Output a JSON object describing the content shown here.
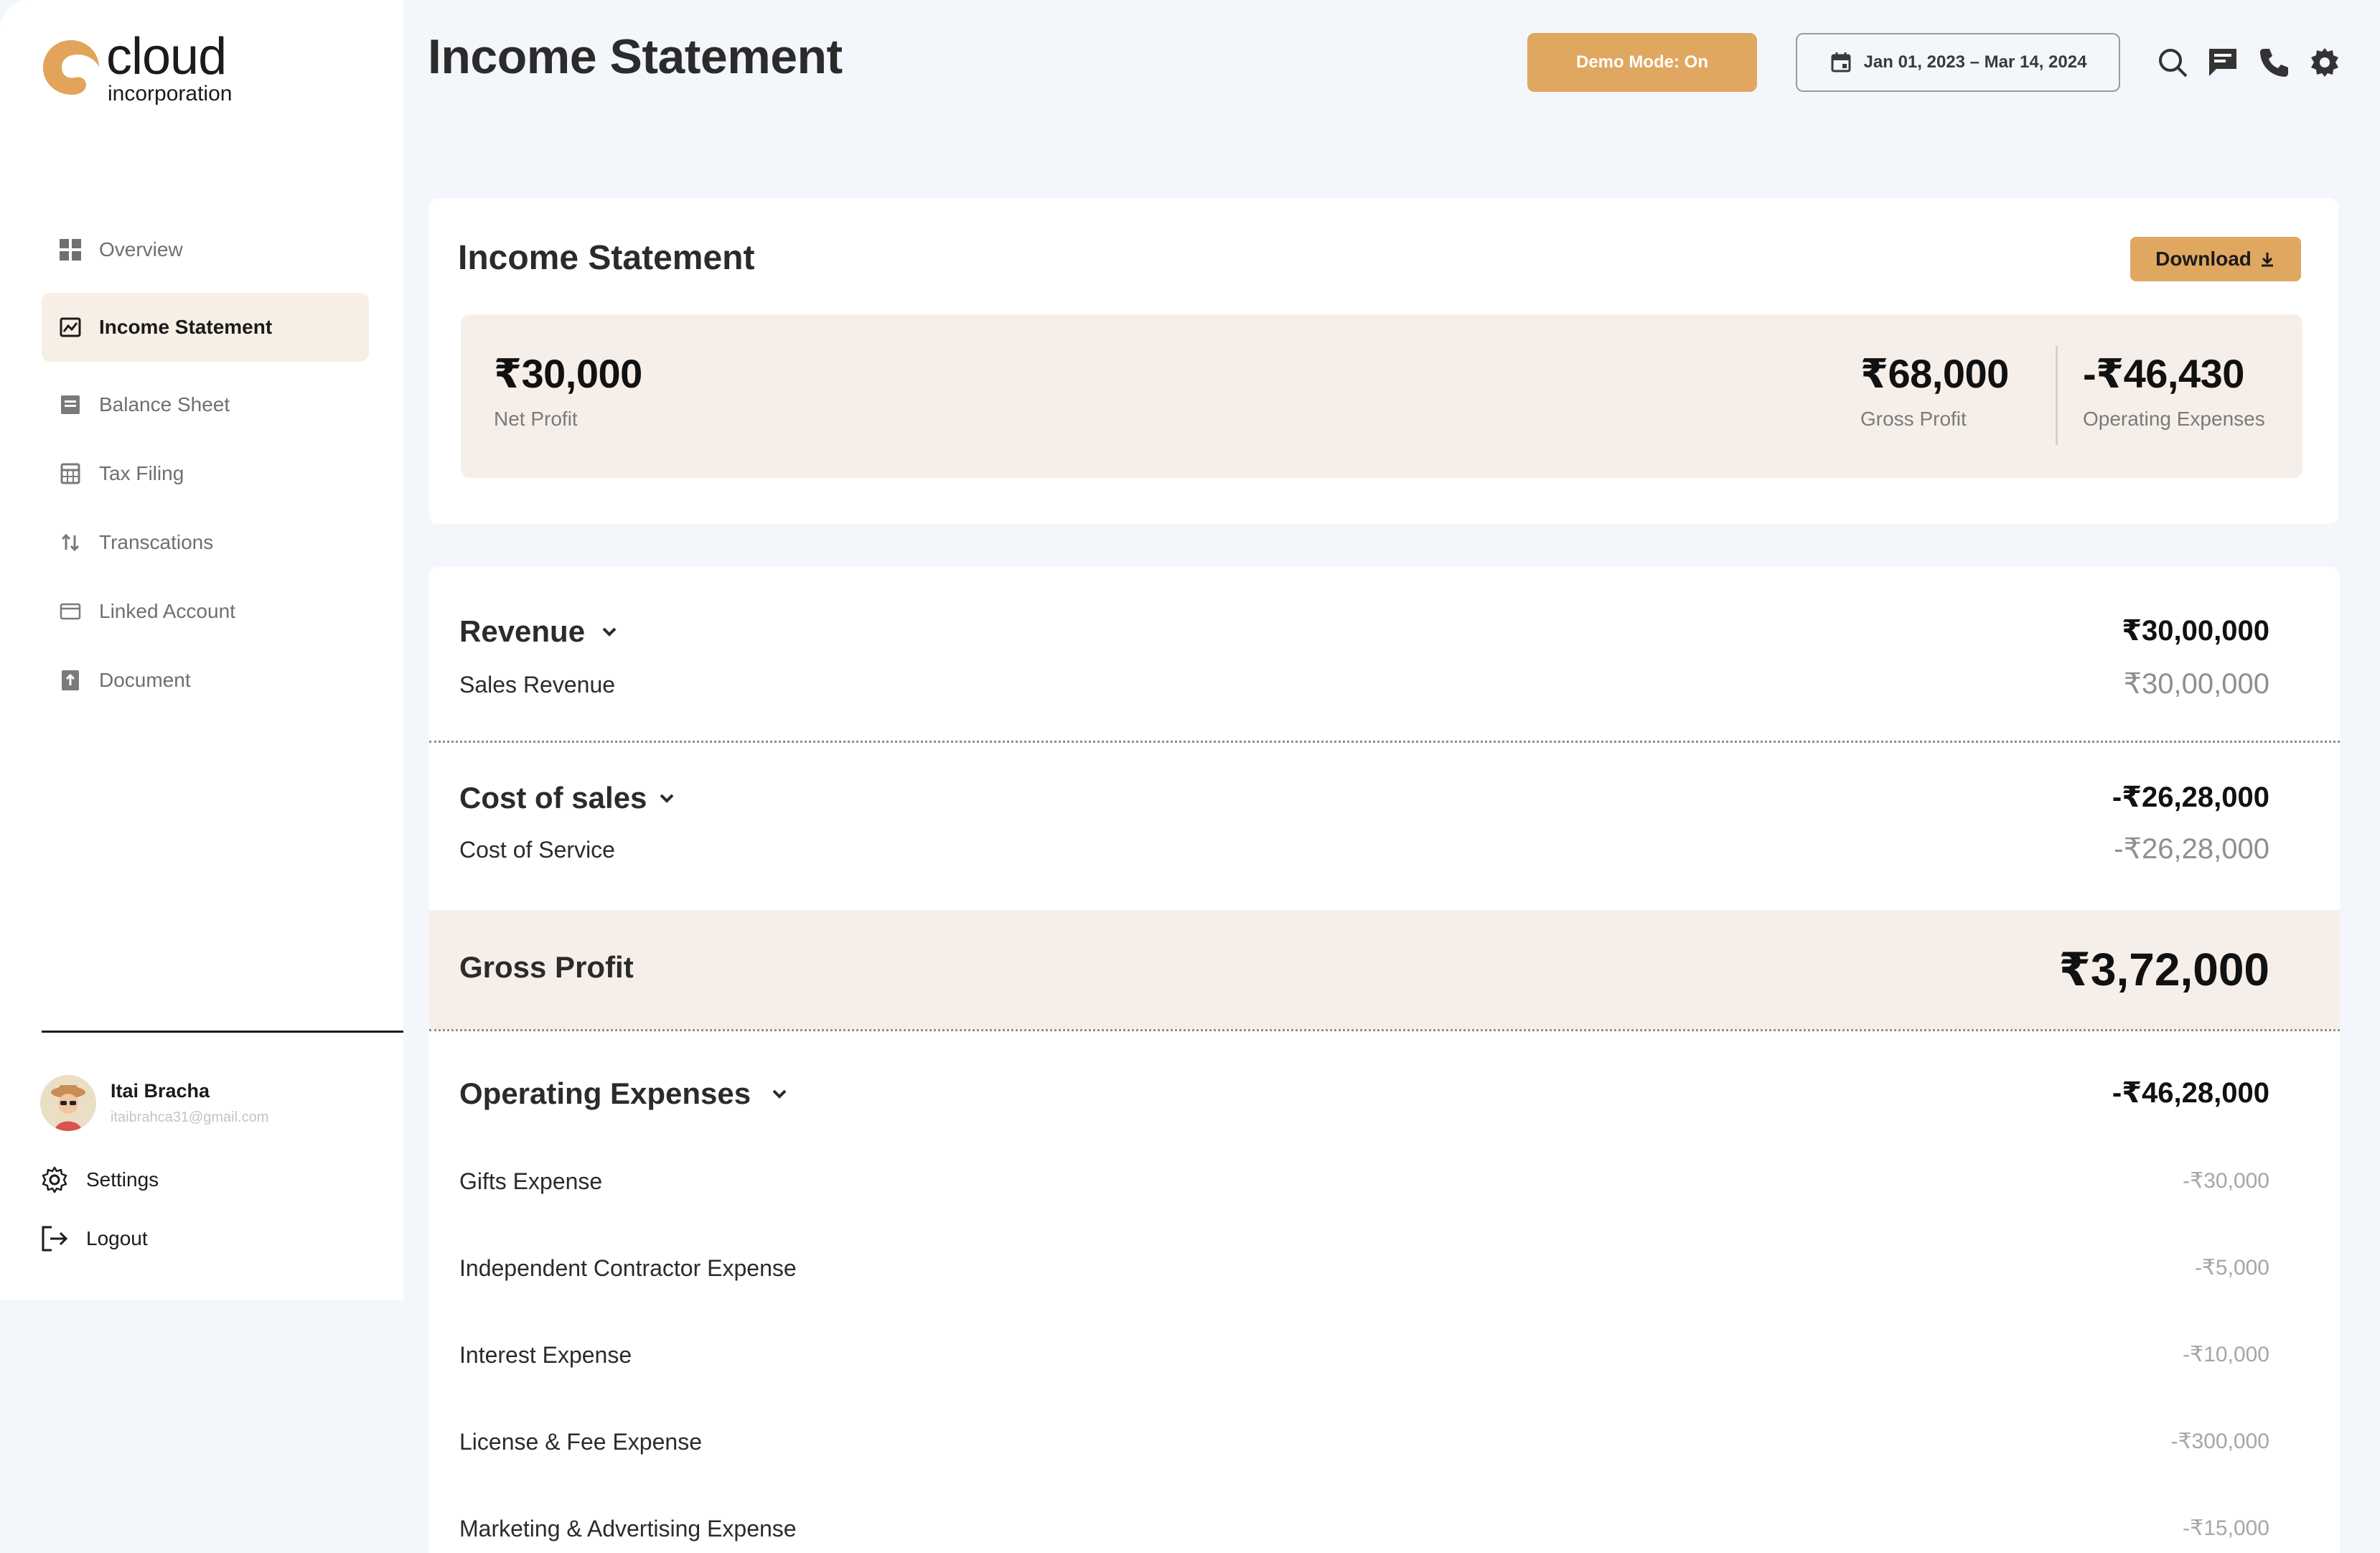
{
  "brand": {
    "name": "cloud",
    "sub": "incorporation",
    "accent": "#dfa75f"
  },
  "sidebar": {
    "items": [
      {
        "label": "Overview",
        "icon": "grid-icon"
      },
      {
        "label": "Income Statement",
        "icon": "chart-image-icon",
        "active": true
      },
      {
        "label": "Balance Sheet",
        "icon": "sheet-icon"
      },
      {
        "label": "Tax Filing",
        "icon": "calculator-icon"
      },
      {
        "label": "Transcations",
        "icon": "sort-arrows-icon"
      },
      {
        "label": "Linked Account",
        "icon": "card-icon"
      },
      {
        "label": "Document",
        "icon": "document-icon"
      }
    ],
    "user": {
      "name": "Itai Bracha",
      "email": "itaibrahca31@gmail.com"
    },
    "settings_label": "Settings",
    "logout_label": "Logout"
  },
  "header": {
    "title": "Income Statement",
    "demo_label": "Demo Mode: On",
    "date_range": "Jan 01, 2023 – Mar 14, 2024"
  },
  "summary_card": {
    "title": "Income Statement",
    "download_label": "Download",
    "net_profit": {
      "value": "₹30,000",
      "label": "Net Profit"
    },
    "gross_profit": {
      "value": "₹68,000",
      "label": "Gross Profit"
    },
    "operating_expenses": {
      "value": "-₹46,430",
      "label": "Operating Expenses"
    }
  },
  "statement": {
    "revenue": {
      "title": "Revenue",
      "total": "₹30,00,000",
      "lines": [
        {
          "label": "Sales Revenue",
          "value": "₹30,00,000"
        }
      ]
    },
    "cost_of_sales": {
      "title": "Cost of sales",
      "total": "-₹26,28,000",
      "lines": [
        {
          "label": "Cost of Service",
          "value": "-₹26,28,000"
        }
      ]
    },
    "gross_profit": {
      "title": "Gross Profit",
      "value": "₹3,72,000"
    },
    "operating_expenses": {
      "title": "Operating Expenses",
      "total": "-₹46,28,000",
      "lines": [
        {
          "label": "Gifts Expense",
          "value": "-₹30,000"
        },
        {
          "label": "Independent Contractor Expense",
          "value": "-₹5,000"
        },
        {
          "label": "Interest Expense",
          "value": "-₹10,000"
        },
        {
          "label": "License & Fee Expense",
          "value": "-₹300,000"
        },
        {
          "label": "Marketing & Advertising Expense",
          "value": "-₹15,000"
        }
      ]
    }
  }
}
